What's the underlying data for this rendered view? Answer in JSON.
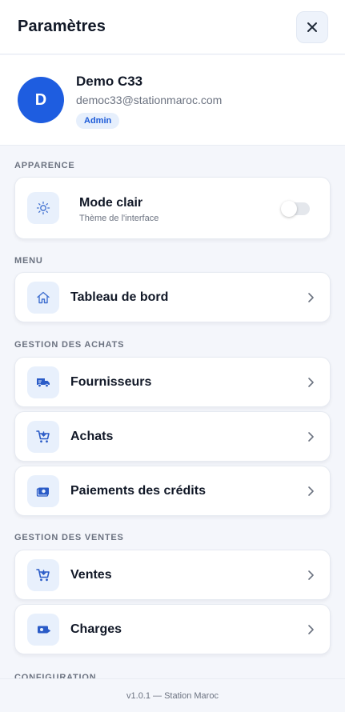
{
  "header": {
    "title": "Paramètres",
    "close_icon": "close-icon"
  },
  "profile": {
    "avatar_initial": "D",
    "name": "Demo C33",
    "email": "democ33@stationmaroc.com",
    "role": "Admin",
    "avatar_color": "#1e5de0"
  },
  "appearance": {
    "section_label": "APPARENCE",
    "mode_title": "Mode clair",
    "mode_subtitle": "Thème de l'interface",
    "icon": "sun-icon",
    "dark_mode_enabled": false
  },
  "menu": {
    "section_label": "MENU",
    "items": [
      {
        "label": "Tableau de bord",
        "icon": "home-icon"
      }
    ]
  },
  "purchases": {
    "section_label": "GESTION DES ACHATS",
    "items": [
      {
        "label": "Fournisseurs",
        "icon": "truck-icon"
      },
      {
        "label": "Achats",
        "icon": "cart-icon"
      },
      {
        "label": "Paiements des crédits",
        "icon": "money-icon"
      }
    ]
  },
  "sales": {
    "section_label": "GESTION DES VENTES",
    "items": [
      {
        "label": "Ventes",
        "icon": "cart-icon"
      },
      {
        "label": "Charges",
        "icon": "payment-icon"
      }
    ]
  },
  "configuration": {
    "section_label": "CONFIGURATION"
  },
  "footer": {
    "version": "v1.0.1 — Station Maroc"
  },
  "colors": {
    "accent": "#1e5de0",
    "icon_bg": "#e8f0fc",
    "background": "#f4f6fb"
  }
}
